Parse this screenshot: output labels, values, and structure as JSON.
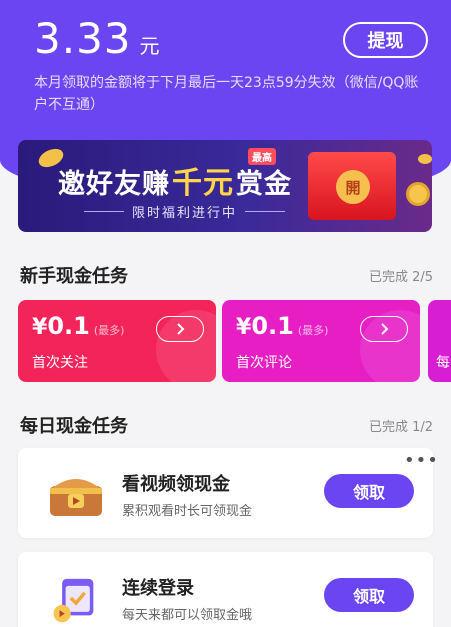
{
  "balance": {
    "amount": "3.33",
    "unit": "元",
    "withdraw_label": "提现"
  },
  "notice": "本月领取的金额将于下月最后一天23点59分失效（微信/QQ账户不互通）",
  "banner": {
    "title_pre": "邀好友赚",
    "title_highlight": "千元",
    "title_post": "赏金",
    "tag": "最高",
    "subtitle": "限时福利进行中",
    "seal_text": "開"
  },
  "newbie": {
    "title": "新手现金任务",
    "progress": "已完成 2/5",
    "tasks": [
      {
        "symbol": "¥",
        "value": "0.1",
        "max_label": "(最多)",
        "label": "首次关注",
        "color": "#f2245a"
      },
      {
        "symbol": "¥",
        "value": "0.1",
        "max_label": "(最多)",
        "label": "首次评论",
        "color": "#e61ec4"
      },
      {
        "label": "每",
        "color": "#d81ed2"
      }
    ],
    "go_icon": "chevron-right-icon"
  },
  "daily": {
    "title": "每日现金任务",
    "progress": "已完成 1/2",
    "tasks": [
      {
        "title": "看视频领现金",
        "desc": "累积观看时长可领现金",
        "button": "领取",
        "icon": "treasure-chest-icon",
        "more": "•••"
      },
      {
        "title": "连续登录",
        "desc": "每天来都可以领取金哦",
        "button": "领取",
        "icon": "calendar-check-icon"
      }
    ]
  },
  "colors": {
    "primary": "#6c45f2",
    "red": "#f2245a",
    "magenta": "#e61ec4"
  }
}
